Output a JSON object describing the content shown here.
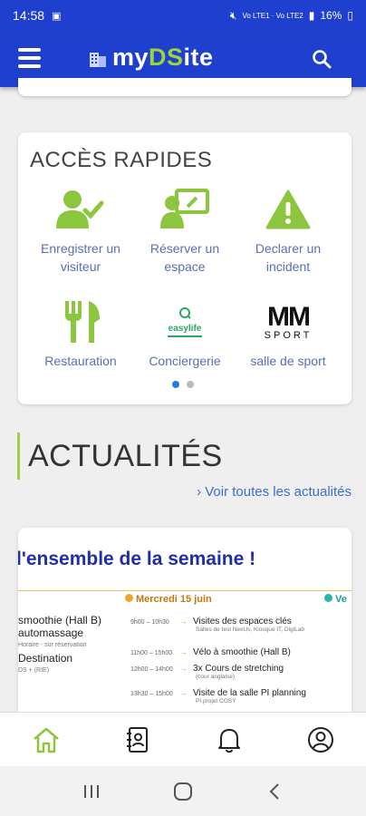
{
  "status": {
    "time": "14:58",
    "battery": "16%",
    "signal": "Vo LTE1 · Vo LTE2"
  },
  "header": {
    "logo_my": "my",
    "logo_ds": "DS",
    "logo_ite": "ite"
  },
  "quick_access": {
    "title": "ACCÈS RAPIDES",
    "tiles": [
      {
        "line1": "Enregistrer un",
        "line2": "visiteur"
      },
      {
        "line1": "Réserver un",
        "line2": "espace"
      },
      {
        "line1": "Declarer un",
        "line2": "incident"
      },
      {
        "line1": "Restauration"
      },
      {
        "line1": "Conciergerie",
        "logo": "easylife"
      },
      {
        "line1": "salle de sport",
        "logo_top": "MM",
        "logo_bottom": "SPORT"
      }
    ]
  },
  "news": {
    "title": "ACTUALITÉS",
    "see_all": "› Voir toutes les actualités",
    "card": {
      "headline": "l'ensemble de la semaine !",
      "day": "Mercredi 15 juin",
      "next_day": "Ve",
      "left_items": [
        "smoothie (Hall B)",
        "automassage",
        "Horaire - sur réservation",
        "Destination",
        "DS + (RIE)"
      ],
      "rows": [
        {
          "time": "9h00 – 10h30",
          "title": "Visites des espaces clés",
          "sub": "Salles de test NexUs, Kiosque IT, DigiLab"
        },
        {
          "time": "11h00 – 15h00",
          "title": "Vélo à smoothie (Hall B)"
        },
        {
          "time": "12h00 – 14h00",
          "title": "3x Cours de stretching",
          "sub": "(cour anglaise)"
        },
        {
          "time": "13h30 – 15h00",
          "title": "Visite de la salle PI planning",
          "sub": "PI projet COSY"
        }
      ]
    }
  },
  "colors": {
    "primary": "#1f3fcf",
    "accent_green": "#9ed23a",
    "link_blue": "#3a6fd0",
    "icon_green": "#8cc63f"
  }
}
